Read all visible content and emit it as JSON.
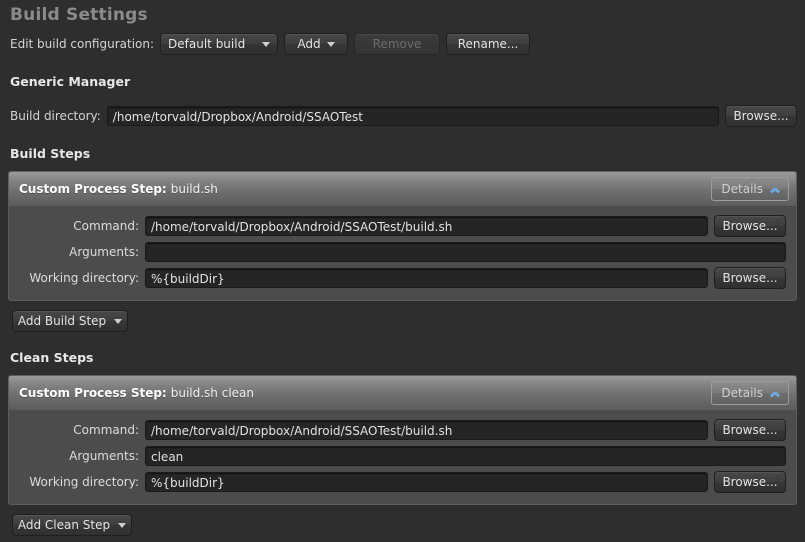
{
  "window": {
    "title": "Build Settings"
  },
  "config_row": {
    "label": "Edit build configuration:",
    "selected": "Default build",
    "add_label": "Add",
    "remove_label": "Remove",
    "remove_disabled": true,
    "rename_label": "Rename..."
  },
  "generic_manager": {
    "title": "Generic Manager",
    "build_directory_label": "Build directory:",
    "build_directory_value": "/home/torvald/Dropbox/Android/SSAOTest",
    "browse_label": "Browse..."
  },
  "build_steps": {
    "title": "Build Steps",
    "add_button_label": "Add Build Step",
    "steps": [
      {
        "type_label": "Custom Process Step:",
        "subject": "build.sh",
        "details_label": "Details",
        "details_icon": "chevron-up-icon",
        "fields": [
          {
            "label": "Command:",
            "value": "/home/torvald/Dropbox/Android/SSAOTest/build.sh",
            "browse": "Browse..."
          },
          {
            "label": "Arguments:",
            "value": "",
            "browse": null
          },
          {
            "label": "Working directory:",
            "value": "%{buildDir}",
            "browse": "Browse..."
          }
        ]
      }
    ]
  },
  "clean_steps": {
    "title": "Clean Steps",
    "add_button_label": "Add Clean Step",
    "steps": [
      {
        "type_label": "Custom Process Step:",
        "subject": "build.sh clean",
        "details_label": "Details",
        "details_icon": "chevron-up-icon",
        "fields": [
          {
            "label": "Command:",
            "value": "/home/torvald/Dropbox/Android/SSAOTest/build.sh",
            "browse": "Browse..."
          },
          {
            "label": "Arguments:",
            "value": "clean",
            "browse": null
          },
          {
            "label": "Working directory:",
            "value": "%{buildDir}",
            "browse": "Browse..."
          }
        ]
      }
    ]
  },
  "colors": {
    "background": "#2e2e2e",
    "field_background": "#252525",
    "panel_body": "#4c4c4c",
    "accent_chevron": "#6fa8dc",
    "title_text": "#8b8b8b"
  }
}
